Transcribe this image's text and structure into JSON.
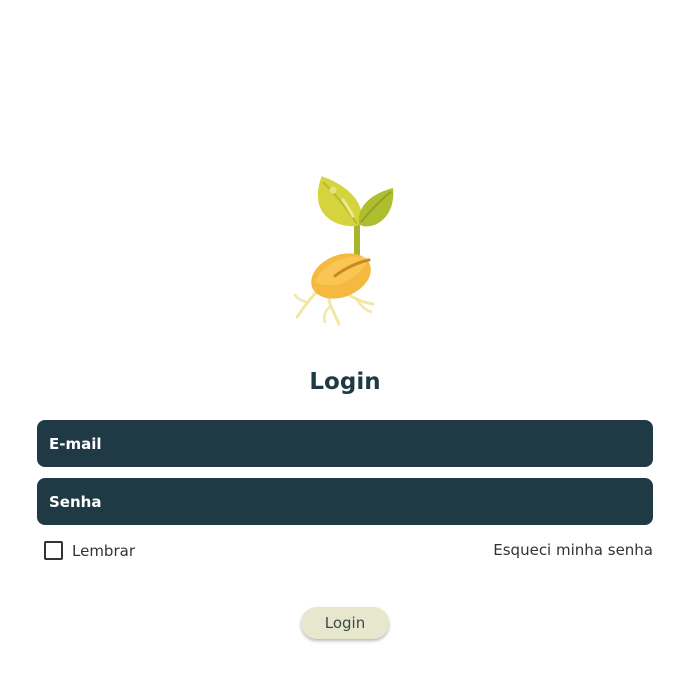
{
  "logo": {
    "icon": "sprout-seed-icon"
  },
  "title": "Login",
  "form": {
    "email_placeholder": "E-mail",
    "password_placeholder": "Senha",
    "remember_label": "Lembrar",
    "remember_checked": false,
    "forgot_label": "Esqueci minha senha",
    "login_label": "Login"
  },
  "colors": {
    "field_background": "#1f3a44",
    "title": "#1f3a44",
    "button_background": "#e6e7cc",
    "leaf": "#c8cd3c",
    "seed": "#f5b940"
  }
}
